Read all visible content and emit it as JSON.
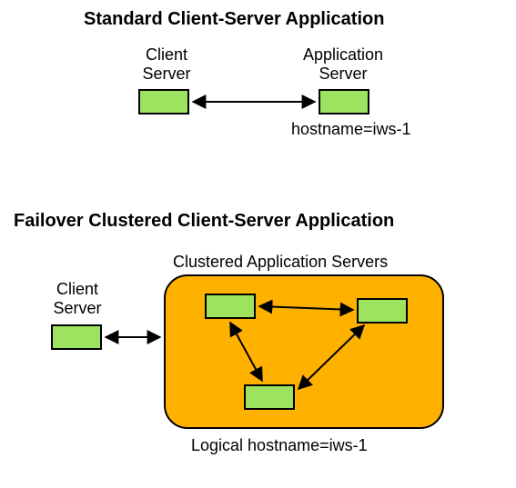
{
  "diagram1": {
    "title": "Standard Client-Server Application",
    "client_label_line1": "Client",
    "client_label_line2": "Server",
    "appserver_label_line1": "Application",
    "appserver_label_line2": "Server",
    "hostname": "hostname=iws-1"
  },
  "diagram2": {
    "title": "Failover Clustered Client-Server Application",
    "cluster_label": "Clustered Application Servers",
    "client_label_line1": "Client",
    "client_label_line2": "Server",
    "logical_hostname": "Logical hostname=iws-1"
  }
}
